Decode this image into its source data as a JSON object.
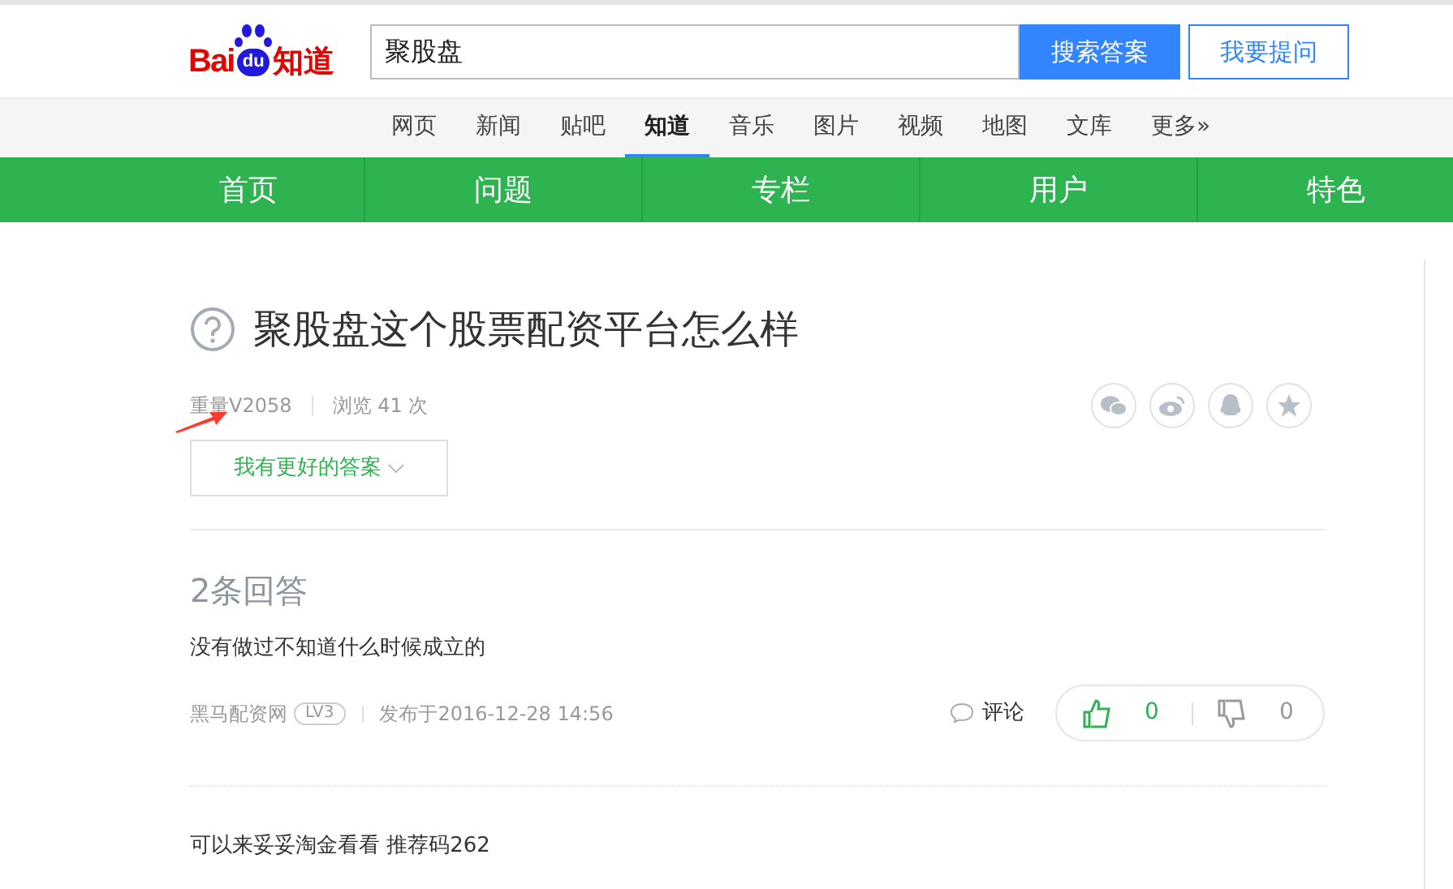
{
  "header": {
    "logo": {
      "left": "Bai",
      "paw": "du",
      "right": "知道"
    },
    "search": {
      "value": "聚股盘"
    },
    "search_button": "搜索答案",
    "ask_button": "我要提问"
  },
  "nav_tabs": [
    {
      "label": "网页",
      "selected": false
    },
    {
      "label": "新闻",
      "selected": false
    },
    {
      "label": "贴吧",
      "selected": false
    },
    {
      "label": "知道",
      "selected": true
    },
    {
      "label": "音乐",
      "selected": false
    },
    {
      "label": "图片",
      "selected": false
    },
    {
      "label": "视频",
      "selected": false
    },
    {
      "label": "地图",
      "selected": false
    },
    {
      "label": "文库",
      "selected": false
    },
    {
      "label": "更多»",
      "selected": false
    }
  ],
  "green_menu": [
    "首页",
    "问题",
    "专栏",
    "用户",
    "特色"
  ],
  "question": {
    "title": "聚股盘这个股票配资平台怎么样",
    "author": "重量V2058",
    "views": "浏览 41 次",
    "better_answer_button": "我有更好的答案"
  },
  "answers_count": "2条回答",
  "answers": [
    {
      "text": "没有做过不知道什么时候成立的",
      "author": "黑马配资网",
      "level": "LV3",
      "date": "发布于2016-12-28 14:56",
      "comment": "评论",
      "likes": "0",
      "dislikes": "0"
    },
    {
      "text": "可以来妥妥淘金看看 推荐码262"
    }
  ]
}
